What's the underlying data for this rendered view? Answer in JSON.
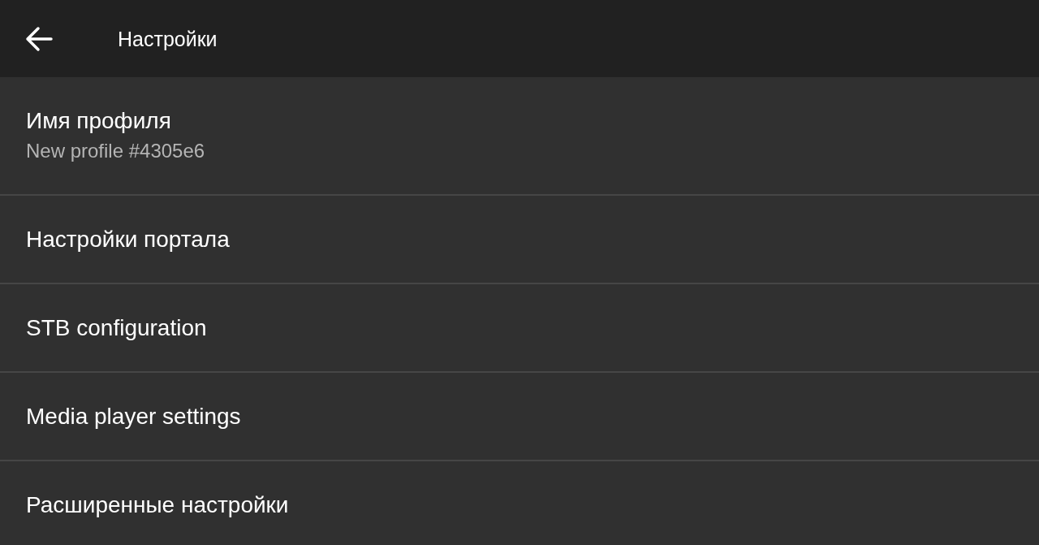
{
  "app_bar": {
    "title": "Настройки"
  },
  "items": [
    {
      "title": "Имя профиля",
      "summary": "New profile #4305e6"
    },
    {
      "title": "Настройки портала"
    },
    {
      "title": "STB configuration"
    },
    {
      "title": "Media player settings"
    },
    {
      "title": "Расширенные настройки"
    }
  ]
}
